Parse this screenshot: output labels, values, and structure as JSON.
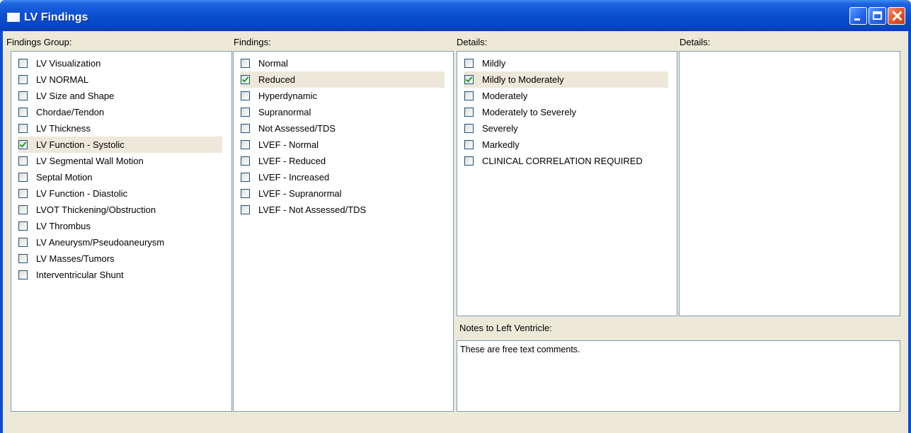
{
  "window": {
    "title": "LV Findings"
  },
  "columns": {
    "findings_group_label": "Findings Group:",
    "findings_label": "Findings:",
    "details_label": "Details:",
    "details2_label": "Details:"
  },
  "findings_group": {
    "items": [
      {
        "label": "LV Visualization",
        "checked": false
      },
      {
        "label": "LV NORMAL",
        "checked": false
      },
      {
        "label": "LV Size and Shape",
        "checked": false
      },
      {
        "label": "Chordae/Tendon",
        "checked": false
      },
      {
        "label": "LV Thickness",
        "checked": false
      },
      {
        "label": "LV Function - Systolic",
        "checked": true,
        "selected": true
      },
      {
        "label": "LV Segmental Wall Motion",
        "checked": false
      },
      {
        "label": "Septal Motion",
        "checked": false
      },
      {
        "label": "LV Function - Diastolic",
        "checked": false
      },
      {
        "label": "LVOT Thickening/Obstruction",
        "checked": false
      },
      {
        "label": "LV Thrombus",
        "checked": false
      },
      {
        "label": "LV Aneurysm/Pseudoaneurysm",
        "checked": false
      },
      {
        "label": "LV Masses/Tumors",
        "checked": false
      },
      {
        "label": "Interventricular Shunt",
        "checked": false
      }
    ]
  },
  "findings": {
    "items": [
      {
        "label": "Normal",
        "checked": false
      },
      {
        "label": "Reduced",
        "checked": true,
        "selected": true
      },
      {
        "label": "Hyperdynamic",
        "checked": false
      },
      {
        "label": "Supranormal",
        "checked": false
      },
      {
        "label": "Not Assessed/TDS",
        "checked": false
      },
      {
        "label": "LVEF - Normal",
        "checked": false
      },
      {
        "label": "LVEF - Reduced",
        "checked": false
      },
      {
        "label": "LVEF - Increased",
        "checked": false
      },
      {
        "label": "LVEF - Supranormal",
        "checked": false
      },
      {
        "label": "LVEF - Not Assessed/TDS",
        "checked": false
      }
    ]
  },
  "details": {
    "items": [
      {
        "label": "Mildly",
        "checked": false
      },
      {
        "label": "Mildly to Moderately",
        "checked": true,
        "selected": true
      },
      {
        "label": "Moderately",
        "checked": false
      },
      {
        "label": "Moderately to Severely",
        "checked": false
      },
      {
        "label": "Severely",
        "checked": false
      },
      {
        "label": "Markedly",
        "checked": false
      },
      {
        "label": "CLINICAL CORRELATION REQUIRED",
        "checked": false
      }
    ]
  },
  "notes": {
    "label": "Notes to Left Ventricle:",
    "value": "These are free text comments."
  }
}
